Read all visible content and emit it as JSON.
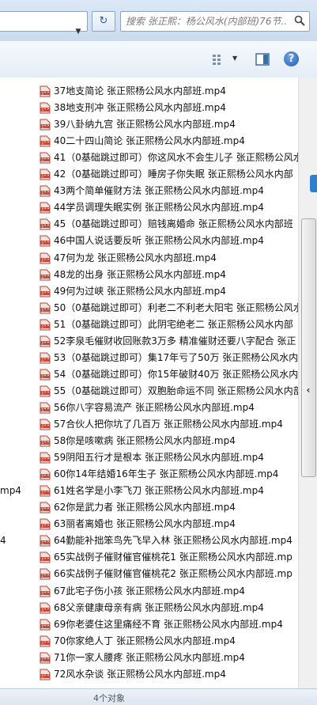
{
  "search": {
    "placeholder": "搜索 张正熙：杨公风水(内部班)76节..."
  },
  "files": [
    "37地支简论   张正熙杨公风水内部班.mp4",
    "38地支刑冲   张正熙杨公风水内部班.mp4",
    "39八卦纳九宫   张正熙杨公风水内部班.mp4",
    "40二十四山简论   张正熙杨公风水内部班.mp4",
    "41（0基础跳过即可）你这风水不会生儿子  张正熙杨公风水",
    "42（0基础跳过即可）睡房子你失眠  张正熙杨公风水内部",
    "43两个简单催财方法   张正熙杨公风水内部班.mp4",
    "44学员调理失眠实例   张正熙杨公风水内部班.mp4",
    "45（0基础跳过即可）赔钱离婚命   张正熙杨公风水内部班",
    "46中国人说话要反听   张正熙杨公风水内部班.mp4",
    "47何为龙  张正熙杨公风水内部班.mp4",
    "48龙的出身   张正熙杨公风水内部班.mp4",
    "49何为过峡   张正熙杨公风水内部班.mp4",
    "50（0基础跳过即可）利老二不利老大阳宅   张正熙杨公风水",
    "51（0基础跳过即可）此阴宅绝老二   张正熙杨公风水内部",
    "52李泉毛催财收回账款3万多  精准催财还要八字配合   张正",
    "53（0基础跳过即可）集17年亏了50万  张正熙杨公风水内",
    "54（0基础跳过即可）你15年破财40万  张正熙杨公风水内",
    "55（0基础跳过即可）双胞胎命运不同  张正熙杨公风水内部",
    "56你八字容易流产   张正熙杨公风水内部班.mp4",
    "57合伙人把你坑了几百万   张正熙杨公风水内部班.mp4",
    "58你是咳嗽病   张正熙杨公风水内部班.mp4",
    "59阴阳五行才是根本   张正熙杨公风水内部班.mp4",
    "60你14年结婚16年生子   张正熙杨公风水内部班.mp4",
    "61姓名学是小李飞刀   张正熙杨公风水内部班.mp4",
    "62你是武力者   张正熙杨公风水内部班.mp4",
    "63丽者离婚也   张正熙杨公风水内部班.mp4",
    "64勤能补拙笨鸟先飞早入林   张正熙杨公风水内部班.mp4",
    "65实战例子催财催官催桃花1   张正熙杨公风水内部班.mp",
    "66实战例子催财催官催桃花2   张正熙杨公风水内部班.mp",
    "67此宅子伤小孩   张正熙杨公风水内部班.mp4",
    "68父亲健康母亲有病   张正熙杨公风水内部班.mp4",
    "69你老婆住这里痛经不育   张正熙杨公风水内部班.mp4",
    "70你家绝人丁  张正熙杨公风水内部班.mp4",
    "71你一家人腰疼  张正熙杨公风水内部班.mp4",
    "72风水杂谈   张正熙杨公风水内部班.mp4"
  ],
  "left_column_fragments": [
    "mp4",
    "4"
  ],
  "status": {
    "text": "4个对象"
  },
  "colors": {
    "header_bg": "#d6e4f3",
    "pdf_icon": "#c84b3c",
    "accent": "#2f7fd0"
  }
}
